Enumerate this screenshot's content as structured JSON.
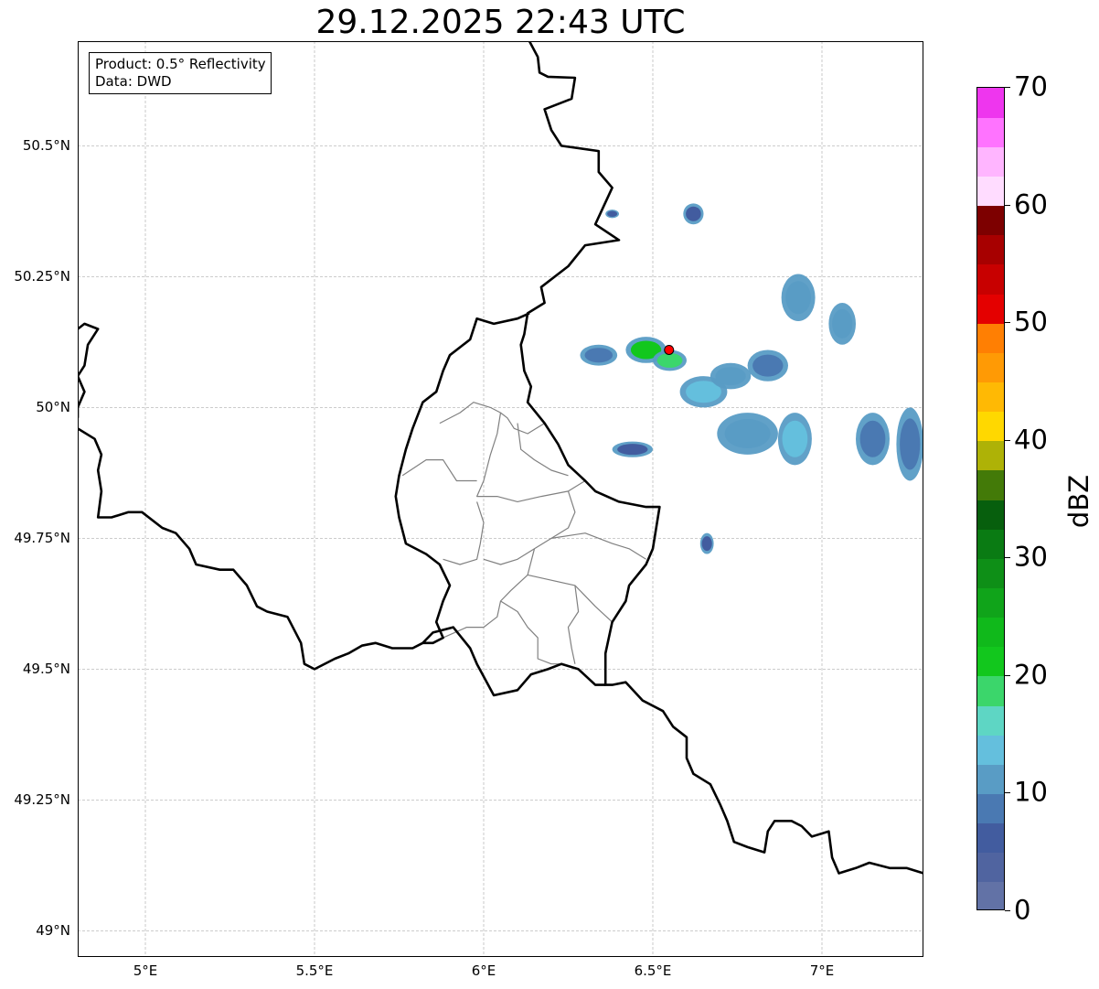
{
  "title": "29.12.2025 22:43 UTC",
  "info": {
    "product": "Product: 0.5° Reflectivity",
    "data": "Data: DWD"
  },
  "map": {
    "extent": {
      "lon": [
        4.8,
        7.3
      ],
      "lat": [
        48.95,
        50.7
      ]
    },
    "lat_ticks": [
      {
        "value": 50.5,
        "label": "50.5°N"
      },
      {
        "value": 50.25,
        "label": "50.25°N"
      },
      {
        "value": 50.0,
        "label": "50°N"
      },
      {
        "value": 49.75,
        "label": "49.75°N"
      },
      {
        "value": 49.5,
        "label": "49.5°N"
      },
      {
        "value": 49.25,
        "label": "49.25°N"
      },
      {
        "value": 49.0,
        "label": "49°N"
      }
    ],
    "lon_ticks": [
      {
        "value": 5.0,
        "label": "5°E"
      },
      {
        "value": 5.5,
        "label": "5.5°E"
      },
      {
        "value": 6.0,
        "label": "6°E"
      },
      {
        "value": 6.5,
        "label": "6.5°E"
      },
      {
        "value": 7.0,
        "label": "7°E"
      }
    ],
    "grid": "dashed",
    "radar_site": {
      "lon": 6.548,
      "lat": 50.11,
      "color": "#ff0000"
    },
    "country_borders": [
      [
        [
          6.135,
          50.7
        ],
        [
          6.16,
          50.67
        ],
        [
          6.165,
          50.64
        ],
        [
          6.19,
          50.632
        ],
        [
          6.27,
          50.63
        ],
        [
          6.26,
          50.59
        ],
        [
          6.18,
          50.57
        ],
        [
          6.2,
          50.53
        ],
        [
          6.23,
          50.5
        ],
        [
          6.34,
          50.49
        ],
        [
          6.34,
          50.45
        ],
        [
          6.38,
          50.42
        ],
        [
          6.33,
          50.35
        ],
        [
          6.4,
          50.32
        ],
        [
          6.3,
          50.31
        ],
        [
          6.25,
          50.27
        ],
        [
          6.17,
          50.23
        ],
        [
          6.18,
          50.2
        ],
        [
          6.13,
          50.18
        ],
        [
          6.12,
          50.14
        ],
        [
          6.11,
          50.12
        ],
        [
          6.12,
          50.07
        ],
        [
          6.14,
          50.04
        ],
        [
          6.13,
          50.01
        ],
        [
          6.18,
          49.97
        ],
        [
          6.22,
          49.93
        ],
        [
          6.25,
          49.89
        ],
        [
          6.3,
          49.86
        ],
        [
          6.33,
          49.84
        ],
        [
          6.4,
          49.82
        ],
        [
          6.48,
          49.81
        ],
        [
          6.52,
          49.81
        ],
        [
          6.51,
          49.77
        ],
        [
          6.5,
          49.73
        ],
        [
          6.48,
          49.7
        ],
        [
          6.43,
          49.66
        ],
        [
          6.42,
          49.63
        ],
        [
          6.38,
          49.59
        ],
        [
          6.36,
          49.53
        ],
        [
          6.36,
          49.47
        ],
        [
          6.38,
          49.47
        ],
        [
          6.42,
          49.475
        ],
        [
          6.47,
          49.44
        ],
        [
          6.53,
          49.42
        ],
        [
          6.56,
          49.39
        ],
        [
          6.6,
          49.37
        ],
        [
          6.6,
          49.33
        ],
        [
          6.62,
          49.3
        ],
        [
          6.67,
          49.28
        ],
        [
          6.7,
          49.24
        ],
        [
          6.72,
          49.21
        ],
        [
          6.74,
          49.17
        ],
        [
          6.78,
          49.16
        ],
        [
          6.83,
          49.15
        ],
        [
          6.84,
          49.19
        ],
        [
          6.86,
          49.21
        ],
        [
          6.91,
          49.21
        ],
        [
          6.94,
          49.2
        ],
        [
          6.97,
          49.18
        ],
        [
          7.02,
          49.19
        ],
        [
          7.03,
          49.14
        ],
        [
          7.05,
          49.11
        ],
        [
          7.1,
          49.12
        ],
        [
          7.14,
          49.13
        ],
        [
          7.2,
          49.12
        ],
        [
          7.25,
          49.12
        ],
        [
          7.3,
          49.11
        ]
      ],
      [
        [
          4.8,
          49.96
        ],
        [
          4.85,
          49.94
        ],
        [
          4.87,
          49.91
        ],
        [
          4.86,
          49.88
        ],
        [
          4.87,
          49.84
        ],
        [
          4.86,
          49.79
        ],
        [
          4.9,
          49.79
        ],
        [
          4.95,
          49.8
        ],
        [
          4.99,
          49.8
        ],
        [
          5.05,
          49.77
        ],
        [
          5.09,
          49.76
        ],
        [
          5.13,
          49.73
        ],
        [
          5.15,
          49.7
        ],
        [
          5.22,
          49.69
        ],
        [
          5.26,
          49.69
        ],
        [
          5.3,
          49.66
        ],
        [
          5.33,
          49.62
        ],
        [
          5.36,
          49.61
        ],
        [
          5.42,
          49.6
        ],
        [
          5.46,
          49.55
        ],
        [
          5.47,
          49.51
        ],
        [
          5.5,
          49.5
        ],
        [
          5.56,
          49.52
        ],
        [
          5.6,
          49.53
        ],
        [
          5.64,
          49.545
        ],
        [
          5.68,
          49.55
        ],
        [
          5.73,
          49.54
        ],
        [
          5.79,
          49.54
        ],
        [
          5.82,
          49.55
        ],
        [
          5.85,
          49.57
        ],
        [
          5.91,
          49.58
        ],
        [
          5.96,
          49.54
        ],
        [
          5.98,
          49.51
        ],
        [
          6.03,
          49.45
        ],
        [
          6.1,
          49.46
        ],
        [
          6.14,
          49.49
        ],
        [
          6.19,
          49.5
        ],
        [
          6.23,
          49.51
        ],
        [
          6.28,
          49.5
        ],
        [
          6.33,
          49.47
        ],
        [
          6.36,
          49.47
        ]
      ],
      [
        [
          4.8,
          50.15
        ],
        [
          4.82,
          50.16
        ],
        [
          4.86,
          50.15
        ],
        [
          4.83,
          50.12
        ],
        [
          4.82,
          50.08
        ],
        [
          4.8,
          50.06
        ],
        [
          4.82,
          50.03
        ],
        [
          4.8,
          50.0
        ],
        [
          4.8,
          49.98
        ]
      ]
    ],
    "luxembourg_outline": [
      [
        6.135,
        50.18
      ],
      [
        6.1,
        50.17
      ],
      [
        6.03,
        50.16
      ],
      [
        5.98,
        50.17
      ],
      [
        5.96,
        50.13
      ],
      [
        5.9,
        50.1
      ],
      [
        5.88,
        50.07
      ],
      [
        5.86,
        50.03
      ],
      [
        5.82,
        50.01
      ],
      [
        5.79,
        49.96
      ],
      [
        5.77,
        49.92
      ],
      [
        5.75,
        49.87
      ],
      [
        5.74,
        49.83
      ],
      [
        5.75,
        49.79
      ],
      [
        5.77,
        49.74
      ],
      [
        5.83,
        49.72
      ],
      [
        5.87,
        49.7
      ],
      [
        5.9,
        49.66
      ],
      [
        5.88,
        49.63
      ],
      [
        5.86,
        49.59
      ],
      [
        5.88,
        49.56
      ],
      [
        5.85,
        49.55
      ],
      [
        5.82,
        49.55
      ]
    ],
    "district_lines": [
      [
        [
          5.87,
          49.97
        ],
        [
          5.93,
          49.99
        ],
        [
          5.97,
          50.01
        ],
        [
          6.02,
          50.0
        ],
        [
          6.05,
          49.99
        ],
        [
          6.07,
          49.98
        ],
        [
          6.09,
          49.96
        ],
        [
          6.13,
          49.95
        ],
        [
          6.18,
          49.97
        ]
      ],
      [
        [
          6.05,
          49.99
        ],
        [
          6.04,
          49.95
        ],
        [
          6.02,
          49.91
        ],
        [
          6.0,
          49.86
        ],
        [
          5.98,
          49.83
        ],
        [
          6.04,
          49.83
        ],
        [
          6.1,
          49.82
        ],
        [
          6.17,
          49.83
        ],
        [
          6.25,
          49.84
        ],
        [
          6.3,
          49.86
        ]
      ],
      [
        [
          6.1,
          49.97
        ],
        [
          6.11,
          49.92
        ],
        [
          6.15,
          49.9
        ],
        [
          6.2,
          49.88
        ],
        [
          6.25,
          49.87
        ]
      ],
      [
        [
          5.76,
          49.87
        ],
        [
          5.83,
          49.9
        ],
        [
          5.88,
          49.9
        ],
        [
          5.92,
          49.86
        ],
        [
          5.98,
          49.86
        ]
      ],
      [
        [
          5.98,
          49.82
        ],
        [
          6.0,
          49.78
        ],
        [
          5.99,
          49.74
        ],
        [
          5.98,
          49.71
        ],
        [
          5.93,
          49.7
        ],
        [
          5.88,
          49.71
        ]
      ],
      [
        [
          6.25,
          49.84
        ],
        [
          6.27,
          49.8
        ],
        [
          6.25,
          49.77
        ],
        [
          6.2,
          49.75
        ],
        [
          6.15,
          49.73
        ],
        [
          6.1,
          49.71
        ],
        [
          6.05,
          49.7
        ],
        [
          6.0,
          49.71
        ]
      ],
      [
        [
          6.2,
          49.75
        ],
        [
          6.3,
          49.76
        ],
        [
          6.38,
          49.74
        ],
        [
          6.43,
          49.73
        ],
        [
          6.48,
          49.71
        ]
      ],
      [
        [
          6.15,
          49.73
        ],
        [
          6.13,
          49.68
        ],
        [
          6.08,
          49.65
        ],
        [
          6.05,
          49.63
        ],
        [
          6.04,
          49.6
        ],
        [
          6.0,
          49.58
        ],
        [
          5.95,
          49.58
        ],
        [
          5.88,
          49.56
        ]
      ],
      [
        [
          6.13,
          49.68
        ],
        [
          6.2,
          49.67
        ],
        [
          6.27,
          49.66
        ],
        [
          6.3,
          49.64
        ],
        [
          6.33,
          49.62
        ],
        [
          6.38,
          49.59
        ]
      ],
      [
        [
          6.05,
          49.63
        ],
        [
          6.1,
          49.61
        ],
        [
          6.13,
          49.58
        ],
        [
          6.16,
          49.56
        ],
        [
          6.16,
          49.52
        ],
        [
          6.2,
          49.51
        ],
        [
          6.23,
          49.51
        ]
      ],
      [
        [
          6.27,
          49.66
        ],
        [
          6.28,
          49.61
        ],
        [
          6.25,
          49.58
        ],
        [
          6.26,
          49.54
        ],
        [
          6.27,
          49.51
        ]
      ]
    ],
    "precipitation": [
      {
        "lon": 6.34,
        "lat": 50.1,
        "rx": 0.055,
        "ry": 0.02,
        "dbz": 8
      },
      {
        "lon": 6.48,
        "lat": 50.11,
        "rx": 0.06,
        "ry": 0.025,
        "dbz": 22
      },
      {
        "lon": 6.55,
        "lat": 50.09,
        "rx": 0.05,
        "ry": 0.02,
        "dbz": 18
      },
      {
        "lon": 6.65,
        "lat": 50.03,
        "rx": 0.07,
        "ry": 0.03,
        "dbz": 14
      },
      {
        "lon": 6.73,
        "lat": 50.06,
        "rx": 0.06,
        "ry": 0.025,
        "dbz": 10
      },
      {
        "lon": 6.84,
        "lat": 50.08,
        "rx": 0.06,
        "ry": 0.03,
        "dbz": 9
      },
      {
        "lon": 6.78,
        "lat": 49.95,
        "rx": 0.09,
        "ry": 0.04,
        "dbz": 12
      },
      {
        "lon": 6.92,
        "lat": 49.94,
        "rx": 0.05,
        "ry": 0.05,
        "dbz": 14
      },
      {
        "lon": 6.93,
        "lat": 50.21,
        "rx": 0.05,
        "ry": 0.045,
        "dbz": 12
      },
      {
        "lon": 7.06,
        "lat": 50.16,
        "rx": 0.04,
        "ry": 0.04,
        "dbz": 10
      },
      {
        "lon": 7.15,
        "lat": 49.94,
        "rx": 0.05,
        "ry": 0.05,
        "dbz": 8
      },
      {
        "lon": 7.26,
        "lat": 49.93,
        "rx": 0.04,
        "ry": 0.07,
        "dbz": 9
      },
      {
        "lon": 6.44,
        "lat": 49.92,
        "rx": 0.06,
        "ry": 0.015,
        "dbz": 7
      },
      {
        "lon": 6.62,
        "lat": 50.37,
        "rx": 0.03,
        "ry": 0.02,
        "dbz": 6
      },
      {
        "lon": 6.38,
        "lat": 50.37,
        "rx": 0.02,
        "ry": 0.008,
        "dbz": 6
      },
      {
        "lon": 6.66,
        "lat": 49.74,
        "rx": 0.02,
        "ry": 0.02,
        "dbz": 6
      }
    ]
  },
  "colorbar": {
    "label": "dBZ",
    "min": 0,
    "max": 70,
    "ticks": [
      {
        "value": 0,
        "label": "0"
      },
      {
        "value": 10,
        "label": "10"
      },
      {
        "value": 20,
        "label": "20"
      },
      {
        "value": 30,
        "label": "30"
      },
      {
        "value": 40,
        "label": "40"
      },
      {
        "value": 50,
        "label": "50"
      },
      {
        "value": 60,
        "label": "60"
      },
      {
        "value": 70,
        "label": "70"
      }
    ],
    "colors": [
      "#6272a6",
      "#5064a0",
      "#425c9f",
      "#4a79b2",
      "#599cc5",
      "#64bfdd",
      "#5ed6c4",
      "#3bd66b",
      "#12c71d",
      "#10b91b",
      "#10a41a",
      "#0e8f17",
      "#0a7b13",
      "#075f0d",
      "#437a08",
      "#aeb206",
      "#ffd800",
      "#ffb904",
      "#ff9a05",
      "#ff7f03",
      "#e40000",
      "#c80000",
      "#a70000",
      "#7d0000",
      "#ffdcff",
      "#ffb5ff",
      "#ff73ff",
      "#ee36ee"
    ]
  }
}
